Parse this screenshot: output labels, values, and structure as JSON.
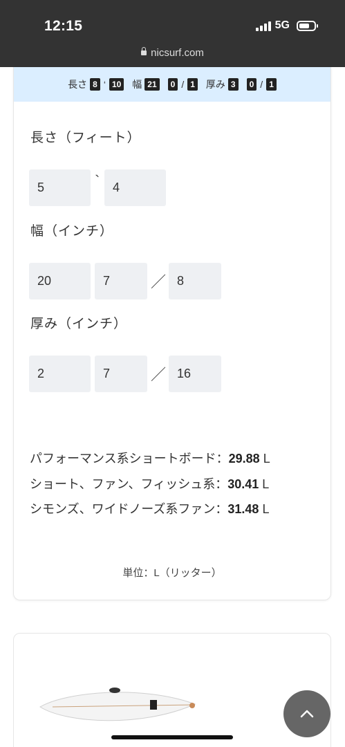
{
  "status_bar": {
    "time": "12:15",
    "network": "5G",
    "url": "nicsurf.com"
  },
  "summary": {
    "length_label": "長さ",
    "length_ft": "8",
    "length_sep": "‘",
    "length_in": "10",
    "width_label": "幅",
    "width_in": "21",
    "width_num": "0",
    "width_slash": "/",
    "width_den": "1",
    "thickness_label": "厚み",
    "thickness_in": "3",
    "thickness_num": "0",
    "thickness_slash": "/",
    "thickness_den": "1"
  },
  "length": {
    "label": "長さ（フィート）",
    "feet": "5",
    "separator": "`",
    "inches": "4"
  },
  "width": {
    "label": "幅（インチ）",
    "whole": "20",
    "numerator": "7",
    "slash": "／",
    "denominator": "8"
  },
  "thickness": {
    "label": "厚み（インチ）",
    "whole": "2",
    "numerator": "7",
    "slash": "／",
    "denominator": "16"
  },
  "results": [
    {
      "label": "パフォーマンス系ショートボード：",
      "value": "29.88",
      "unit": " L"
    },
    {
      "label": "ショート、ファン、フィッシュ系：",
      "value": "30.41",
      "unit": " L"
    },
    {
      "label": "シモンズ、ワイドノーズ系ファン：",
      "value": "31.48",
      "unit": " L"
    }
  ],
  "unit_note": "単位：L（リッター）",
  "icons": {
    "scroll_top": "chevron-up-icon",
    "lock": "lock-icon",
    "signal": "signal-icon",
    "battery": "battery-icon"
  },
  "colors": {
    "summary_bg": "#dbeeff",
    "field_bg": "#eef0f3",
    "status_bar": "#333333",
    "fab": "#666666"
  }
}
